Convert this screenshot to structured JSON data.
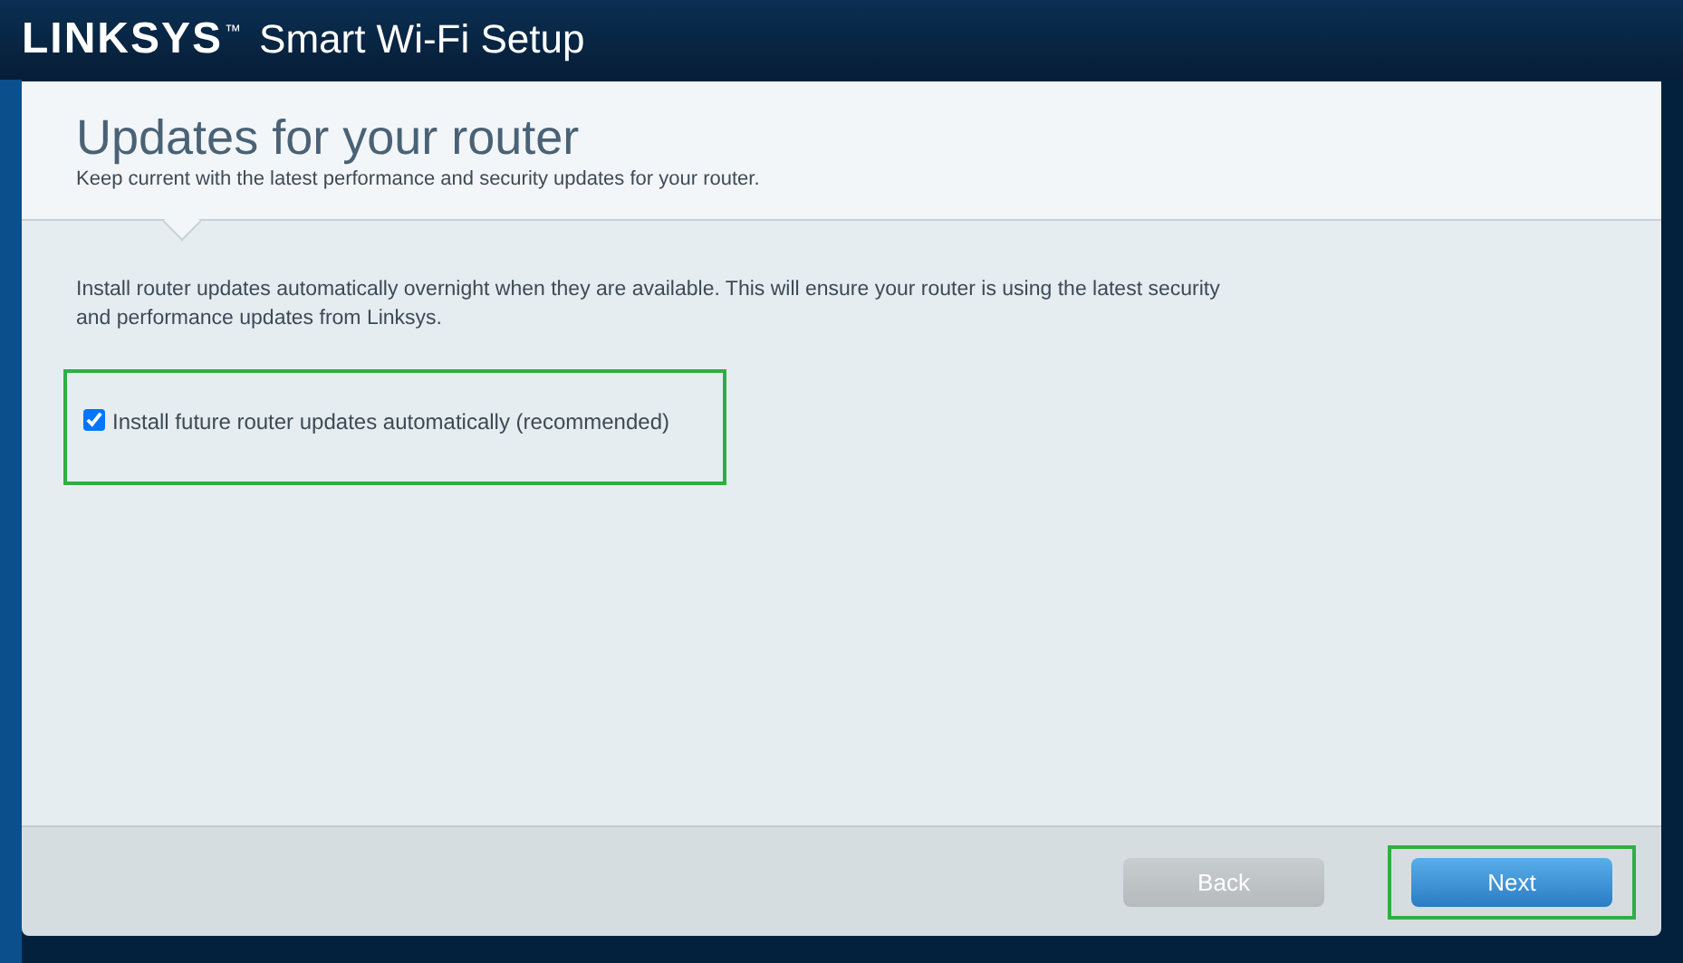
{
  "header": {
    "brand": "LINKSYS",
    "trademark": "™",
    "title": "Smart Wi-Fi Setup"
  },
  "page": {
    "title": "Updates for your router",
    "subtitle": "Keep current with the latest performance and security updates for your router."
  },
  "body": {
    "description": "Install router updates automatically overnight when they are available. This will ensure your router is using the latest security and performance updates from Linksys.",
    "option": {
      "label": "Install future router updates automatically (recommended)",
      "checked": true,
      "highlighted": true
    }
  },
  "buttons": [
    {
      "label": "Back",
      "kind": "secondary",
      "disabled": true,
      "highlighted": false
    },
    {
      "label": "Next",
      "kind": "primary",
      "disabled": false,
      "highlighted": true
    }
  ]
}
